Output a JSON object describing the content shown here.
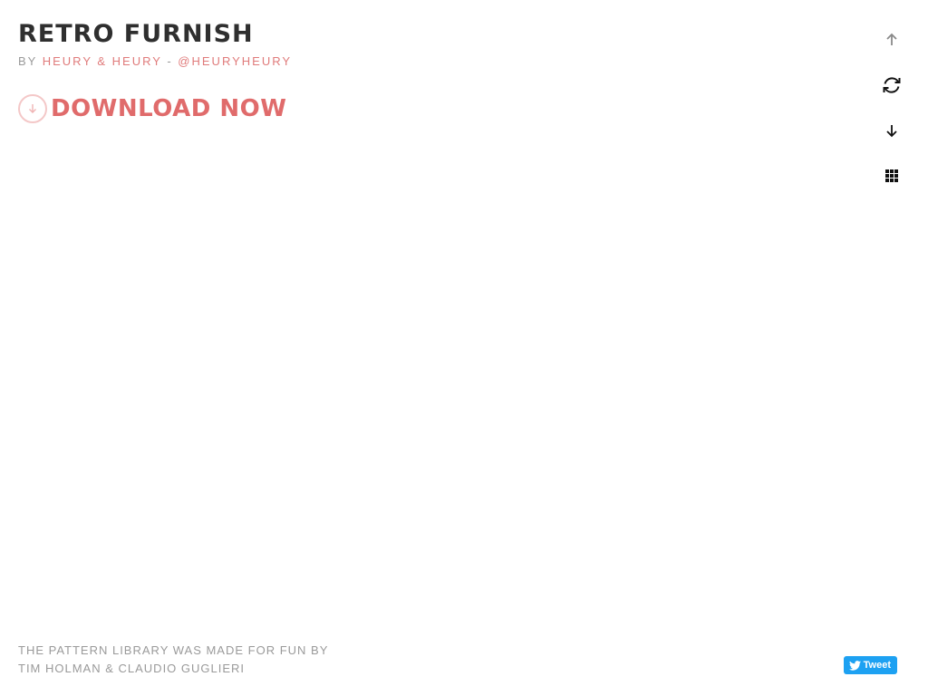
{
  "header": {
    "title": "Retro Furnish",
    "by_prefix": "by",
    "author": "Heury & Heury",
    "separator": "-",
    "handle": "@heuryheury"
  },
  "download": {
    "label": "Download Now",
    "icon": "arrow-down-circle-icon"
  },
  "controls": [
    {
      "icon": "arrow-up-icon"
    },
    {
      "icon": "refresh-icon"
    },
    {
      "icon": "arrow-down-icon"
    },
    {
      "icon": "grid-icon"
    }
  ],
  "footer": {
    "line1": "The pattern library was made for fun by",
    "line2": "Tim Holman & Claudio Guglieri"
  },
  "tweet": {
    "label": "Tweet",
    "icon": "twitter-bird-icon"
  },
  "colors": {
    "accent": "#e06b6b",
    "title": "#2f2f2f",
    "muted": "#9a9a9a",
    "tweet_bg": "#1da1f2"
  }
}
